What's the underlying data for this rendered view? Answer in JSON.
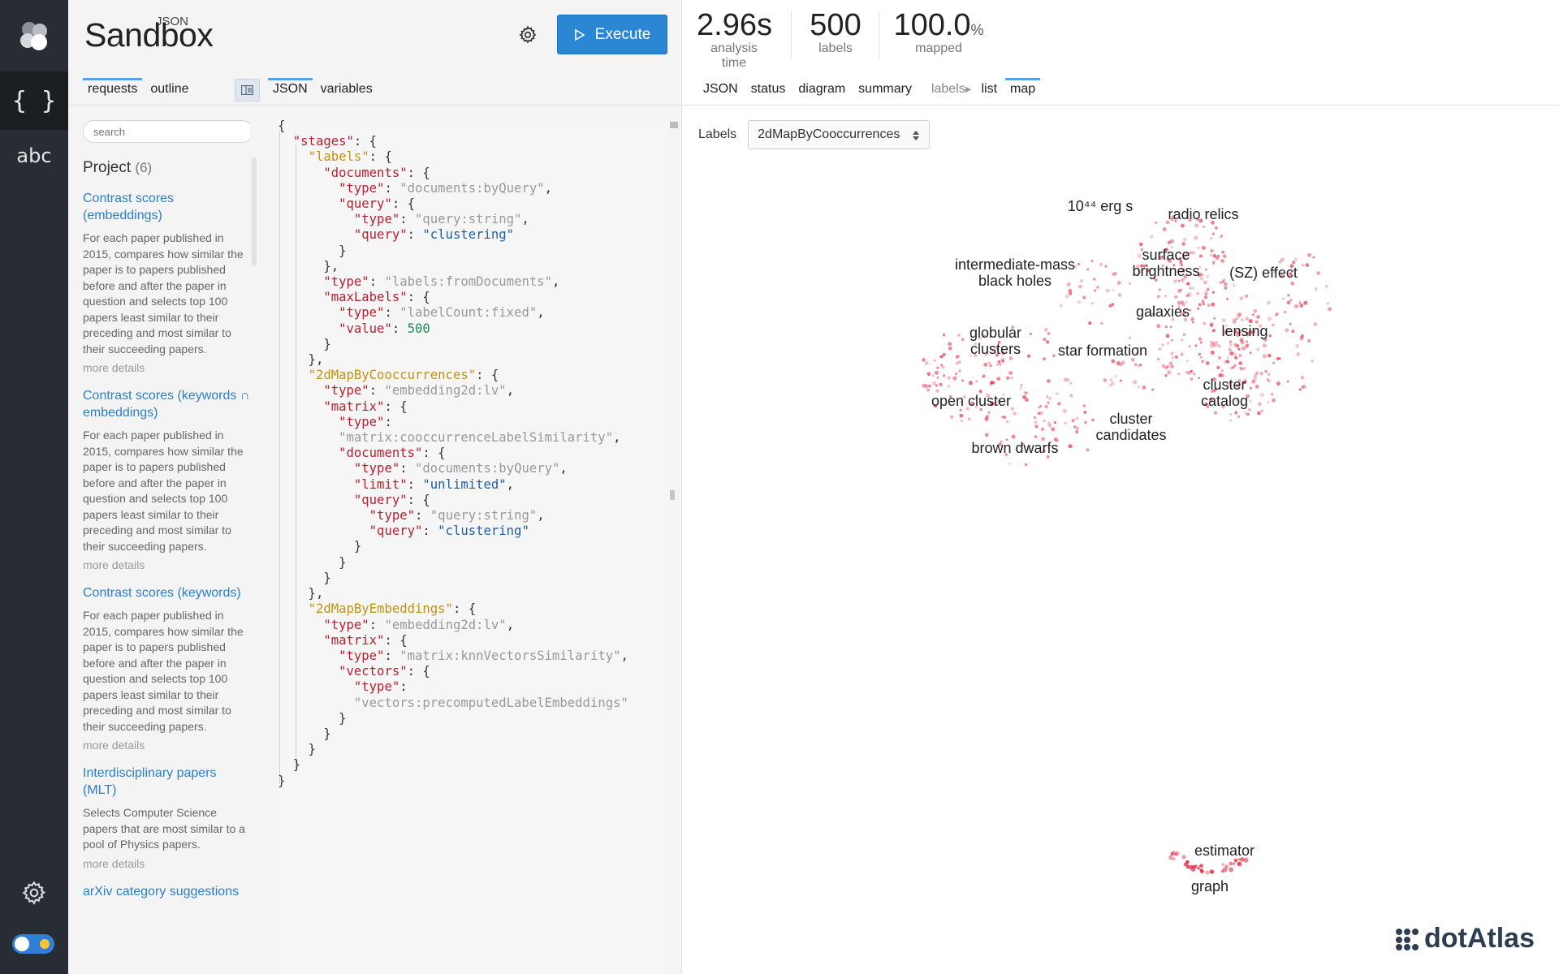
{
  "rail": {
    "items": [
      {
        "name": "json",
        "glyph": "{ }"
      },
      {
        "name": "abc",
        "glyph": "abc"
      }
    ]
  },
  "brand": {
    "sup": "JSON",
    "name": "Sandbox"
  },
  "toolbar": {
    "execute_label": "Execute"
  },
  "left_tabs": [
    "requests",
    "outline"
  ],
  "editor_tabs": [
    "JSON",
    "variables"
  ],
  "requests": {
    "search_placeholder": "search",
    "project_label": "Project",
    "project_count": "(6)",
    "items": [
      {
        "title": "Contrast scores (embeddings)",
        "desc": "For each paper published in 2015, compares how similar the paper is to papers published before and after the paper in question and selects top 100 papers least similar to their preceding and most similar to their succeeding papers.",
        "more": "more details"
      },
      {
        "title": "Contrast scores (keywords ∩ embeddings)",
        "desc": "For each paper published in 2015, compares how similar the paper is to papers published before and after the paper in question and selects top 100 papers least similar to their preceding and most similar to their succeeding papers.",
        "more": "more details"
      },
      {
        "title": "Contrast scores (keywords)",
        "desc": "For each paper published in 2015, compares how similar the paper is to papers published before and after the paper in question and selects top 100 papers least similar to their preceding and most similar to their succeeding papers.",
        "more": "more details"
      },
      {
        "title": "Interdisciplinary papers (MLT)",
        "desc": "Selects Computer Science papers that are most similar to a pool of Physics papers.",
        "more": "more details"
      },
      {
        "title": "arXiv category suggestions",
        "desc": "",
        "more": ""
      }
    ]
  },
  "editor": {
    "lines": [
      [
        [
          "p",
          "{"
        ]
      ],
      [
        [
          "p",
          "  "
        ],
        [
          "k",
          "\"stages\""
        ],
        [
          "p",
          ": {"
        ]
      ],
      [
        [
          "p",
          "    "
        ],
        [
          "kk",
          "\"labels\""
        ],
        [
          "p",
          ": {"
        ]
      ],
      [
        [
          "p",
          "      "
        ],
        [
          "k",
          "\"documents\""
        ],
        [
          "p",
          ": {"
        ]
      ],
      [
        [
          "p",
          "        "
        ],
        [
          "k",
          "\"type\""
        ],
        [
          "p",
          ": "
        ],
        [
          "s",
          "\"documents:byQuery\""
        ],
        [
          "p",
          ","
        ]
      ],
      [
        [
          "p",
          "        "
        ],
        [
          "k",
          "\"query\""
        ],
        [
          "p",
          ": {"
        ]
      ],
      [
        [
          "p",
          "          "
        ],
        [
          "k",
          "\"type\""
        ],
        [
          "p",
          ": "
        ],
        [
          "s",
          "\"query:string\""
        ],
        [
          "p",
          ","
        ]
      ],
      [
        [
          "p",
          "          "
        ],
        [
          "k",
          "\"query\""
        ],
        [
          "p",
          ": "
        ],
        [
          "v",
          "\"clustering\""
        ]
      ],
      [
        [
          "p",
          "        }"
        ]
      ],
      [
        [
          "p",
          "      },"
        ]
      ],
      [
        [
          "p",
          "      "
        ],
        [
          "k",
          "\"type\""
        ],
        [
          "p",
          ": "
        ],
        [
          "s",
          "\"labels:fromDocuments\""
        ],
        [
          "p",
          ","
        ]
      ],
      [
        [
          "p",
          "      "
        ],
        [
          "k",
          "\"maxLabels\""
        ],
        [
          "p",
          ": {"
        ]
      ],
      [
        [
          "p",
          "        "
        ],
        [
          "k",
          "\"type\""
        ],
        [
          "p",
          ": "
        ],
        [
          "s",
          "\"labelCount:fixed\""
        ],
        [
          "p",
          ","
        ]
      ],
      [
        [
          "p",
          "        "
        ],
        [
          "k",
          "\"value\""
        ],
        [
          "p",
          ": "
        ],
        [
          "n",
          "500"
        ]
      ],
      [
        [
          "p",
          "      }"
        ]
      ],
      [
        [
          "p",
          "    },"
        ]
      ],
      [
        [
          "p",
          "    "
        ],
        [
          "kk",
          "\"2dMapByCooccurrences\""
        ],
        [
          "p",
          ": {"
        ]
      ],
      [
        [
          "p",
          "      "
        ],
        [
          "k",
          "\"type\""
        ],
        [
          "p",
          ": "
        ],
        [
          "s",
          "\"embedding2d:lv\""
        ],
        [
          "p",
          ","
        ]
      ],
      [
        [
          "p",
          "      "
        ],
        [
          "k",
          "\"matrix\""
        ],
        [
          "p",
          ": {"
        ]
      ],
      [
        [
          "p",
          "        "
        ],
        [
          "k",
          "\"type\""
        ],
        [
          "p",
          ":"
        ]
      ],
      [
        [
          "p",
          "        "
        ],
        [
          "s",
          "\"matrix:cooccurrenceLabelSimilarity\""
        ],
        [
          "p",
          ","
        ]
      ],
      [
        [
          "p",
          "        "
        ],
        [
          "k",
          "\"documents\""
        ],
        [
          "p",
          ": {"
        ]
      ],
      [
        [
          "p",
          "          "
        ],
        [
          "k",
          "\"type\""
        ],
        [
          "p",
          ": "
        ],
        [
          "s",
          "\"documents:byQuery\""
        ],
        [
          "p",
          ","
        ]
      ],
      [
        [
          "p",
          "          "
        ],
        [
          "k",
          "\"limit\""
        ],
        [
          "p",
          ": "
        ],
        [
          "v",
          "\"unlimited\""
        ],
        [
          "p",
          ","
        ]
      ],
      [
        [
          "p",
          "          "
        ],
        [
          "k",
          "\"query\""
        ],
        [
          "p",
          ": {"
        ]
      ],
      [
        [
          "p",
          "            "
        ],
        [
          "k",
          "\"type\""
        ],
        [
          "p",
          ": "
        ],
        [
          "s",
          "\"query:string\""
        ],
        [
          "p",
          ","
        ]
      ],
      [
        [
          "p",
          "            "
        ],
        [
          "k",
          "\"query\""
        ],
        [
          "p",
          ": "
        ],
        [
          "v",
          "\"clustering\""
        ]
      ],
      [
        [
          "p",
          "          }"
        ]
      ],
      [
        [
          "p",
          "        }"
        ]
      ],
      [
        [
          "p",
          "      }"
        ]
      ],
      [
        [
          "p",
          "    },"
        ]
      ],
      [
        [
          "p",
          "    "
        ],
        [
          "kk",
          "\"2dMapByEmbeddings\""
        ],
        [
          "p",
          ": {"
        ]
      ],
      [
        [
          "p",
          "      "
        ],
        [
          "k",
          "\"type\""
        ],
        [
          "p",
          ": "
        ],
        [
          "s",
          "\"embedding2d:lv\""
        ],
        [
          "p",
          ","
        ]
      ],
      [
        [
          "p",
          "      "
        ],
        [
          "k",
          "\"matrix\""
        ],
        [
          "p",
          ": {"
        ]
      ],
      [
        [
          "p",
          "        "
        ],
        [
          "k",
          "\"type\""
        ],
        [
          "p",
          ": "
        ],
        [
          "s",
          "\"matrix:knnVectorsSimilarity\""
        ],
        [
          "p",
          ","
        ]
      ],
      [
        [
          "p",
          "        "
        ],
        [
          "k",
          "\"vectors\""
        ],
        [
          "p",
          ": {"
        ]
      ],
      [
        [
          "p",
          "          "
        ],
        [
          "k",
          "\"type\""
        ],
        [
          "p",
          ":"
        ]
      ],
      [
        [
          "p",
          "          "
        ],
        [
          "s",
          "\"vectors:precomputedLabelEmbeddings\""
        ]
      ],
      [
        [
          "p",
          "        }"
        ]
      ],
      [
        [
          "p",
          "      }"
        ]
      ],
      [
        [
          "p",
          "    }"
        ]
      ],
      [
        [
          "p",
          "  }"
        ]
      ],
      [
        [
          "p",
          "}"
        ]
      ]
    ]
  },
  "stats": [
    {
      "value": "2.96s",
      "unit": "",
      "label": "analysis time"
    },
    {
      "value": "500",
      "unit": "",
      "label": "labels"
    },
    {
      "value": "100.0",
      "unit": "%",
      "label": "mapped"
    }
  ],
  "result_tabs": [
    "JSON",
    "status",
    "diagram",
    "summary"
  ],
  "labels_section": {
    "prefix": "labels",
    "tabs": [
      "list",
      "map"
    ],
    "active": "map"
  },
  "labels_selector": {
    "label": "Labels",
    "value": "2dMapByCooccurrences"
  },
  "map_labels": [
    {
      "text": "10⁴⁴ erg s"
    },
    {
      "text": "radio relics"
    },
    {
      "text": "intermediate-mass\nblack holes"
    },
    {
      "text": "surface\nbrightness"
    },
    {
      "text": "(SZ) effect"
    },
    {
      "text": "galaxies"
    },
    {
      "text": "globular\nclusters"
    },
    {
      "text": "lensing"
    },
    {
      "text": "star formation"
    },
    {
      "text": "cluster\ncatalog"
    },
    {
      "text": "open cluster"
    },
    {
      "text": "cluster\ncandidates"
    },
    {
      "text": "brown dwarfs"
    },
    {
      "text": "estimator"
    },
    {
      "text": "graph"
    }
  ],
  "watermark": "dotAtlas",
  "colors": {
    "accent": "#2b86d4",
    "point": "#e0334a",
    "rail": "#282c34"
  }
}
